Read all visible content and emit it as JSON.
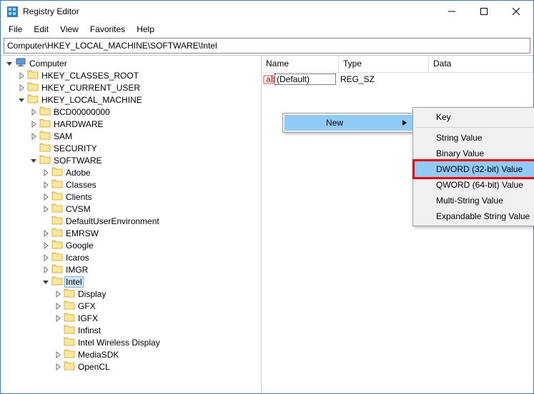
{
  "window": {
    "title": "Registry Editor"
  },
  "menubar": [
    "File",
    "Edit",
    "View",
    "Favorites",
    "Help"
  ],
  "address": "Computer\\HKEY_LOCAL_MACHINE\\SOFTWARE\\Intel",
  "tree": [
    {
      "indent": 0,
      "disc": "open",
      "icon": "pc",
      "label": "Computer"
    },
    {
      "indent": 1,
      "disc": "closed",
      "icon": "folder",
      "label": "HKEY_CLASSES_ROOT"
    },
    {
      "indent": 1,
      "disc": "closed",
      "icon": "folder",
      "label": "HKEY_CURRENT_USER"
    },
    {
      "indent": 1,
      "disc": "open",
      "icon": "folder",
      "label": "HKEY_LOCAL_MACHINE"
    },
    {
      "indent": 2,
      "disc": "closed",
      "icon": "folder",
      "label": "BCD00000000"
    },
    {
      "indent": 2,
      "disc": "closed",
      "icon": "folder",
      "label": "HARDWARE"
    },
    {
      "indent": 2,
      "disc": "closed",
      "icon": "folder",
      "label": "SAM"
    },
    {
      "indent": 2,
      "disc": "none",
      "icon": "folder",
      "label": "SECURITY"
    },
    {
      "indent": 2,
      "disc": "open",
      "icon": "folder",
      "label": "SOFTWARE"
    },
    {
      "indent": 3,
      "disc": "closed",
      "icon": "folder",
      "label": "Adobe"
    },
    {
      "indent": 3,
      "disc": "closed",
      "icon": "folder",
      "label": "Classes"
    },
    {
      "indent": 3,
      "disc": "closed",
      "icon": "folder",
      "label": "Clients"
    },
    {
      "indent": 3,
      "disc": "closed",
      "icon": "folder",
      "label": "CVSM"
    },
    {
      "indent": 3,
      "disc": "none",
      "icon": "folder",
      "label": "DefaultUserEnvironment"
    },
    {
      "indent": 3,
      "disc": "closed",
      "icon": "folder",
      "label": "EMRSW"
    },
    {
      "indent": 3,
      "disc": "closed",
      "icon": "folder",
      "label": "Google"
    },
    {
      "indent": 3,
      "disc": "closed",
      "icon": "folder",
      "label": "Icaros"
    },
    {
      "indent": 3,
      "disc": "closed",
      "icon": "folder",
      "label": "IMGR"
    },
    {
      "indent": 3,
      "disc": "open",
      "icon": "folder",
      "label": "Intel",
      "selected": true
    },
    {
      "indent": 4,
      "disc": "closed",
      "icon": "folder",
      "label": "Display"
    },
    {
      "indent": 4,
      "disc": "closed",
      "icon": "folder",
      "label": "GFX"
    },
    {
      "indent": 4,
      "disc": "closed",
      "icon": "folder",
      "label": "IGFX"
    },
    {
      "indent": 4,
      "disc": "none",
      "icon": "folder",
      "label": "Infinst"
    },
    {
      "indent": 4,
      "disc": "none",
      "icon": "folder",
      "label": "Intel Wireless Display"
    },
    {
      "indent": 4,
      "disc": "closed",
      "icon": "folder",
      "label": "MediaSDK"
    },
    {
      "indent": 4,
      "disc": "closed",
      "icon": "folder",
      "label": "OpenCL"
    }
  ],
  "columns": {
    "name": "Name",
    "type": "Type",
    "data": "Data"
  },
  "values": [
    {
      "name": "(Default)",
      "type": "REG_SZ",
      "data": ""
    }
  ],
  "context": {
    "new": "New",
    "items": [
      "Key",
      "String Value",
      "Binary Value",
      "DWORD (32-bit) Value",
      "QWORD (64-bit) Value",
      "Multi-String Value",
      "Expandable String Value"
    ],
    "highlighted": 3
  }
}
